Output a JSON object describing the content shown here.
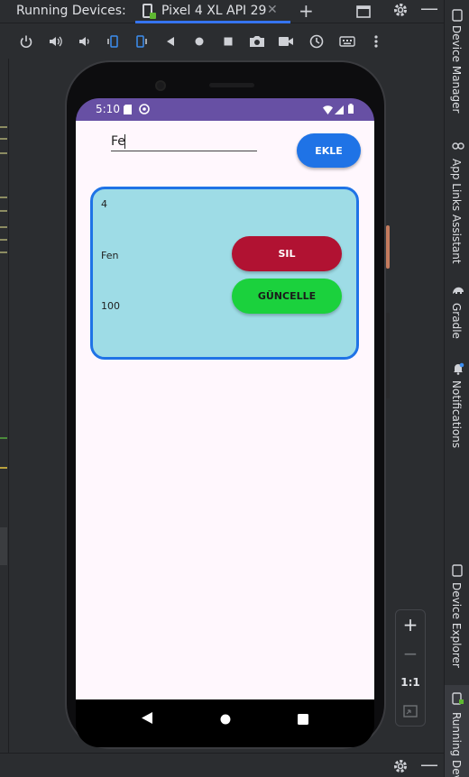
{
  "panel_title": "Running Devices:",
  "device_tab": {
    "label": "Pixel 4 XL API 29",
    "close": "✕"
  },
  "right_sidebar": {
    "device_manager": "Device Manager",
    "app_links": "App Links Assistant",
    "gradle": "Gradle",
    "notifications": "Notifications",
    "device_explorer": "Device Explorer",
    "running_devices": "Running Devices"
  },
  "phone": {
    "status_time": "5:10",
    "input_value": "Fe",
    "ekle_label": "EKLE",
    "card": {
      "id": "4",
      "name": "Fen",
      "value": "100",
      "sil_label": "SIL",
      "guncelle_label": "GÜNCELLE"
    }
  },
  "zoom": {
    "plus": "+",
    "minus": "−",
    "one_to_one": "1:1"
  },
  "colors": {
    "status_bar": "#6750a4",
    "ekle": "#1f73e6",
    "card_bg": "#9edce6",
    "card_border": "#1f73e6",
    "sil": "#b11232",
    "guncelle": "#1bd13d"
  }
}
